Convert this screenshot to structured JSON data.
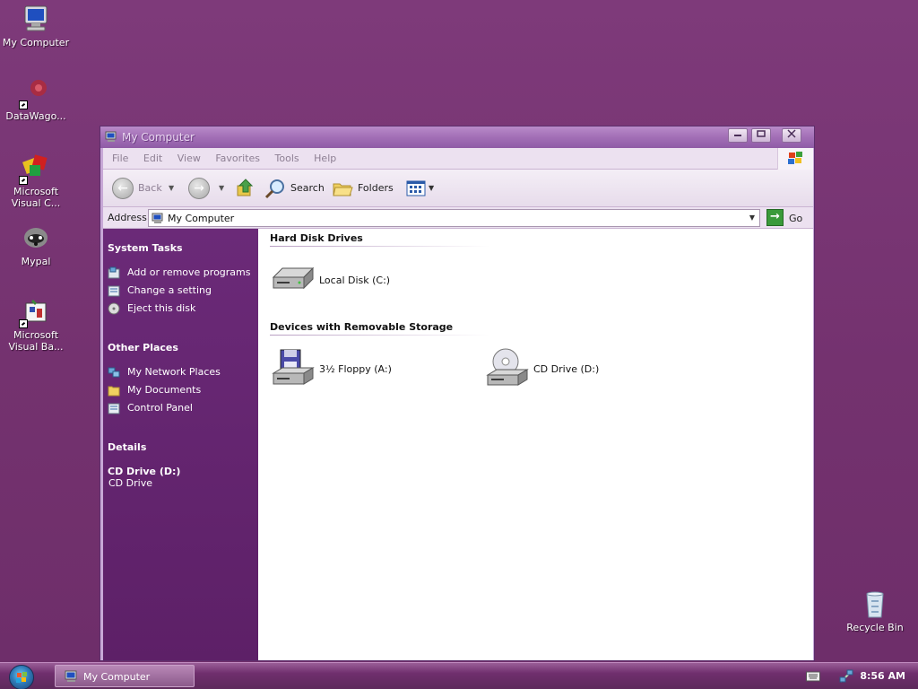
{
  "desktop": {
    "icons": [
      {
        "label": "My Computer"
      },
      {
        "label": "DataWago..."
      },
      {
        "label": "Microsoft Visual C..."
      },
      {
        "label": "Mypal"
      },
      {
        "label": "Microsoft Visual Ba..."
      },
      {
        "label": "Recycle Bin"
      }
    ]
  },
  "window": {
    "title": "My Computer",
    "menu": [
      "File",
      "Edit",
      "View",
      "Favorites",
      "Tools",
      "Help"
    ],
    "toolbar": {
      "back": "Back",
      "search": "Search",
      "folders": "Folders"
    },
    "address": {
      "label": "Address",
      "value": "My Computer",
      "go": "Go"
    },
    "taskpane": {
      "system_tasks": {
        "title": "System Tasks",
        "items": [
          "Add or remove programs",
          "Change a setting",
          "Eject this disk"
        ]
      },
      "other_places": {
        "title": "Other Places",
        "items": [
          "My Network Places",
          "My Documents",
          "Control Panel"
        ]
      },
      "details": {
        "title": "Details",
        "name": "CD Drive (D:)",
        "type": "CD Drive"
      }
    },
    "content": {
      "hard_disk": {
        "title": "Hard Disk Drives",
        "drives": [
          "Local Disk (C:)"
        ]
      },
      "removable": {
        "title": "Devices with Removable Storage",
        "drives": [
          "3½ Floppy (A:)",
          "CD Drive (D:)"
        ]
      }
    }
  },
  "taskbar": {
    "task_label": "My Computer",
    "clock": "8:56 AM"
  }
}
